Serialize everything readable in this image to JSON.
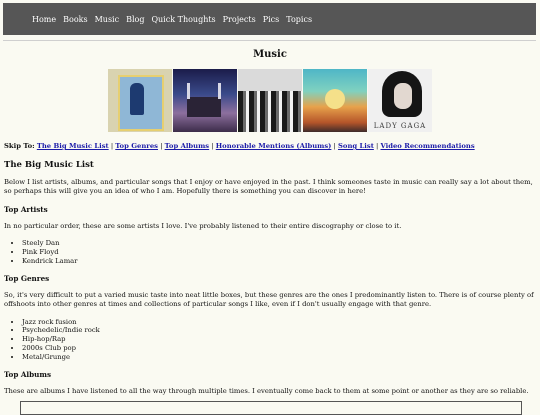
{
  "nav": [
    "Home",
    "Books",
    "Music",
    "Blog",
    "Quick Thoughts",
    "Projects",
    "Pics",
    "Topics"
  ],
  "page_title": "Music",
  "album_covers": [
    {
      "name": "steely-dan-cover"
    },
    {
      "name": "pink-floyd-cover"
    },
    {
      "name": "kendrick-lamar-cover"
    },
    {
      "name": "psychedelic-cover"
    },
    {
      "name": "lady-gaga-cover",
      "text": "LADY GAGA"
    }
  ],
  "skip": {
    "label": "Skip To:",
    "links": [
      "The Big Music List",
      "Top Genres",
      "Top Albums",
      "Honorable Mentions (Albums)",
      "Song List",
      "Video Recommendations"
    ]
  },
  "sections": {
    "big_list_heading": "The Big Music List",
    "big_list_text": "Below I list artists, albums, and particular songs that I enjoy or have enjoyed in the past. I think someones taste in music can really say a lot about them, so perhaps this will give you an idea of who I am. Hopefully there is something you can discover in here!",
    "top_artists_heading": "Top Artists",
    "top_artists_text": "In no particular order, these are some artists I love. I've probably listened to their entire discography or close to it.",
    "top_artists": [
      "Steely Dan",
      "Pink Floyd",
      "Kendrick Lamar"
    ],
    "top_genres_heading": "Top Genres",
    "top_genres_text": "So, it's very difficult to put a varied music taste into neat little boxes, but these genres are the ones I predominantly listen to. There is of course plenty of offshoots into other genres at times and collections of particular songs I like, even if I don't usually engage with that genre.",
    "top_genres": [
      "Jazz rock fusion",
      "Psychedelic/Indie rock",
      "Hip-hop/Rap",
      "2000s Club pop",
      "Metal/Grunge"
    ],
    "top_albums_heading": "Top Albums",
    "top_albums_text": "These are albums I have listened to all the way through multiple times. I eventually come back to them at some point or another as they are so reliable."
  }
}
